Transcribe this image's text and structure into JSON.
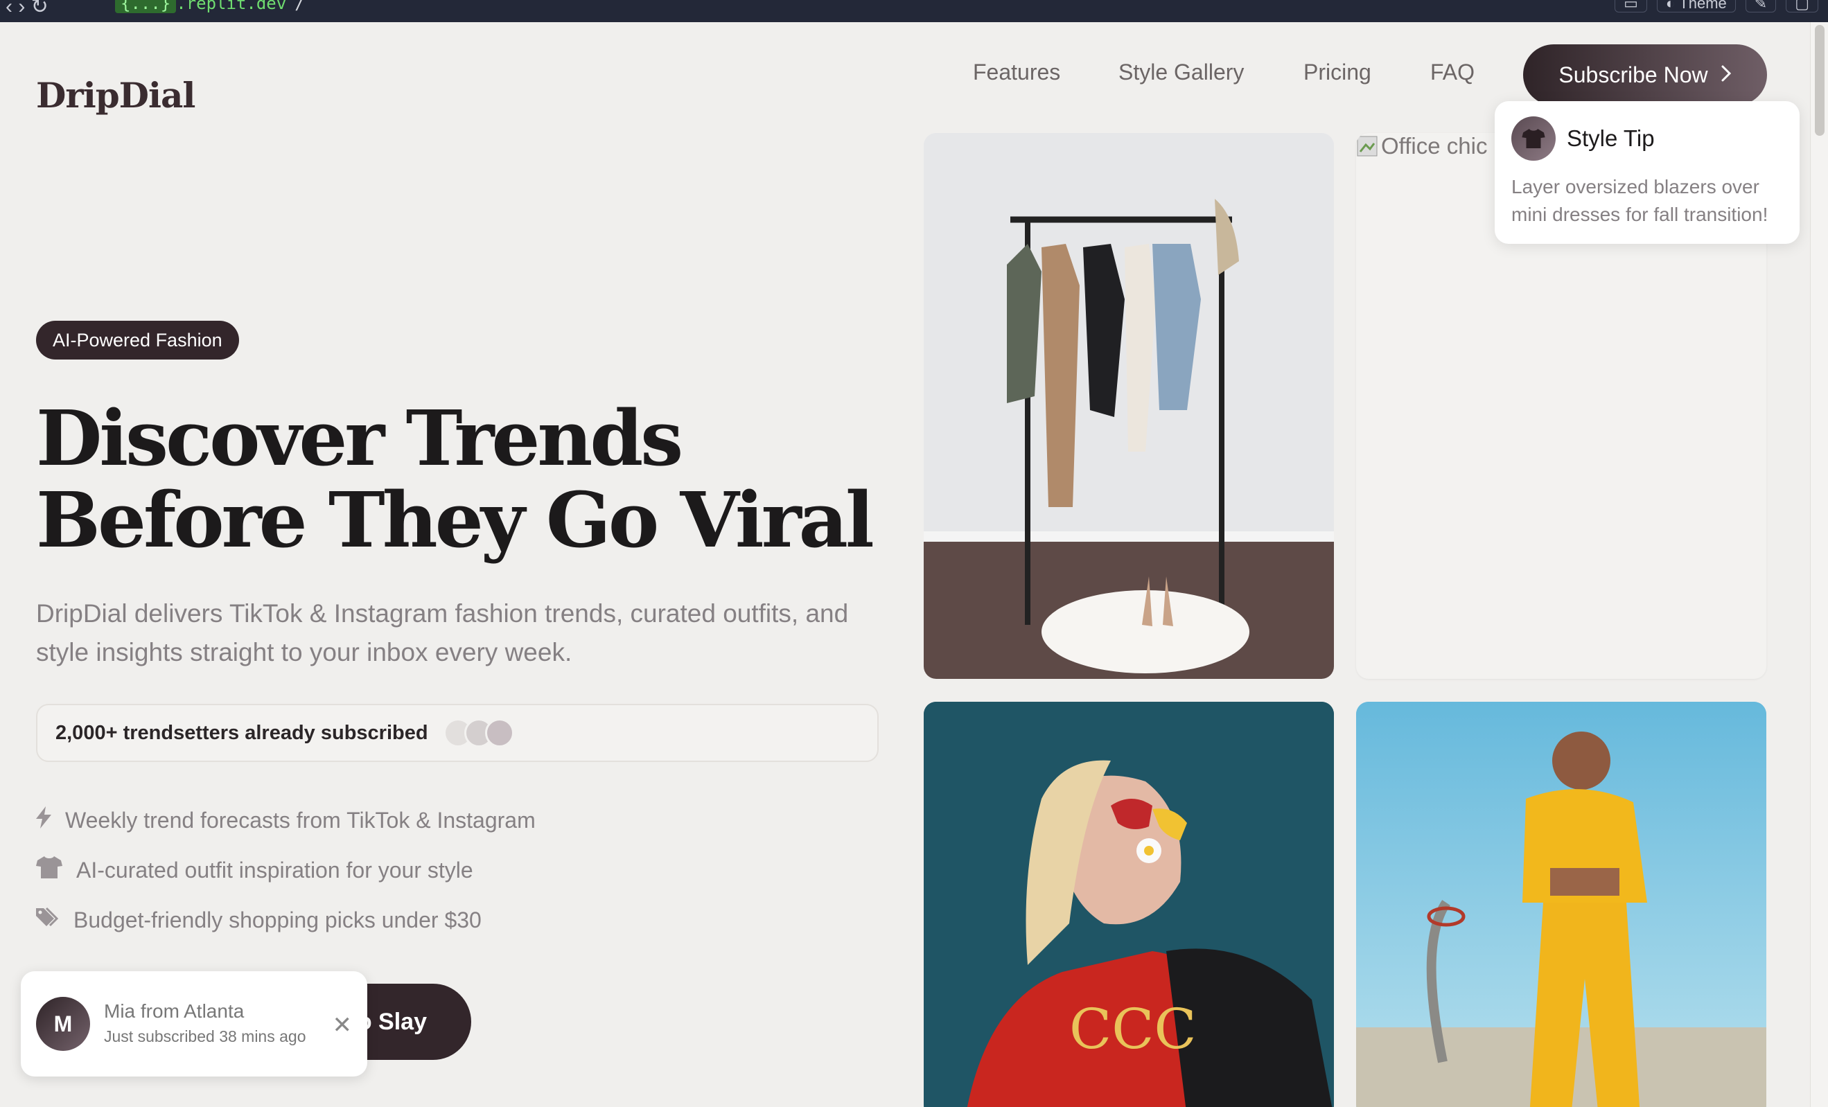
{
  "browser": {
    "url_host_prefix": "{...}",
    "url_host": ".replit.dev",
    "url_path": "/",
    "theme_label": "Theme"
  },
  "header": {
    "logo": "DripDial",
    "nav": [
      "Features",
      "Style Gallery",
      "Pricing",
      "FAQ"
    ],
    "subscribe_label": "Subscribe Now"
  },
  "hero": {
    "badge": "AI-Powered Fashion",
    "headline_line1": "Discover Trends",
    "headline_line2": "Before They Go Viral",
    "subtext": "DripDial delivers TikTok & Instagram fashion trends, curated outfits, and style insights straight to your inbox every week.",
    "social_proof": "2,000+ trendsetters already subscribed",
    "features": [
      {
        "icon": "bolt-icon",
        "text": "Weekly trend forecasts from TikTok & Instagram"
      },
      {
        "icon": "tshirt-icon",
        "text": "AI-curated outfit inspiration for your style"
      },
      {
        "icon": "tags-icon",
        "text": "Budget-friendly shopping picks under $30"
      }
    ],
    "cta_label": "o Slay"
  },
  "toast": {
    "avatar_letter": "M",
    "name": "Mia from Atlanta",
    "message": "Just subscribed 38 mins ago"
  },
  "gallery": {
    "broken_alt": "Office chic"
  },
  "style_tip": {
    "title": "Style Tip",
    "body": "Layer oversized blazers over mini dresses for fall transition!"
  },
  "colors": {
    "primary_dark": "#33262b",
    "background": "#f0efed",
    "muted_text": "#858083"
  }
}
